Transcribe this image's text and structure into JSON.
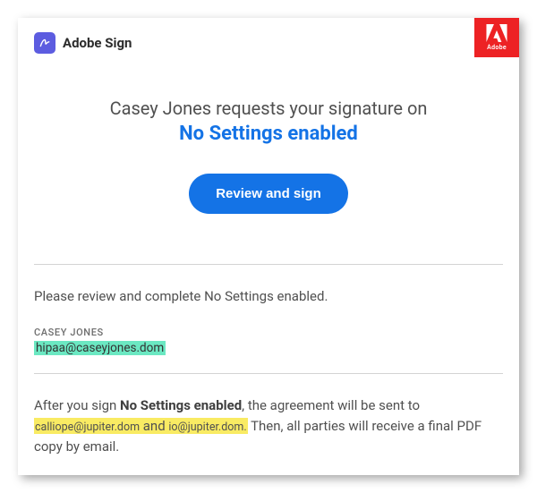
{
  "brand": {
    "name": "Adobe Sign",
    "corp": "Adobe"
  },
  "request": {
    "sender_name": "Casey Jones",
    "verb_phrase": "requests your signature on",
    "document_title": "No Settings enabled"
  },
  "cta": {
    "label": "Review and sign"
  },
  "instruction": {
    "prefix": "Please review and complete ",
    "doc": "No Settings enabled",
    "suffix": "."
  },
  "sender": {
    "name_caps": "CASEY JONES",
    "email": "hipaa@caseyjones.dom"
  },
  "flow": {
    "prefix": "After you sign ",
    "doc": "No Settings enabled",
    "mid": ", the agreement will be sent to ",
    "recipient1": "calliope@jupiter.dom",
    "and": " and ",
    "recipient2": "io@jupiter.dom.",
    "suffix": " Then, all parties will receive a final PDF copy by email."
  }
}
